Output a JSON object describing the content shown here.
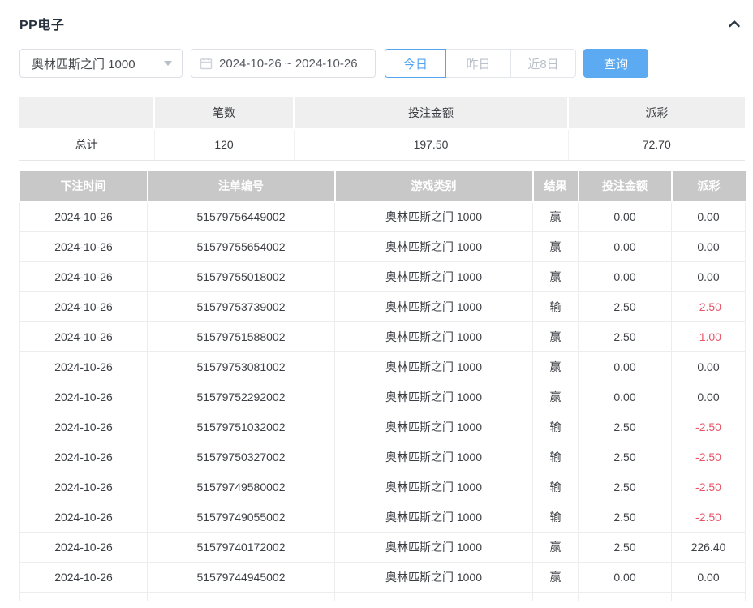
{
  "header": {
    "title": "PP电子",
    "collapse_icon": "chevron-up"
  },
  "filters": {
    "game_select": {
      "value": "奥林匹斯之门 1000",
      "icon": "chevron-down-icon"
    },
    "date_range": {
      "value": "2024-10-26 ~ 2024-10-26",
      "icon": "calendar-icon"
    },
    "quick": [
      {
        "label": "今日",
        "active": true
      },
      {
        "label": "昨日",
        "active": false
      },
      {
        "label": "近8日",
        "active": false
      }
    ],
    "query_label": "查询"
  },
  "summary": {
    "headers": [
      "",
      "笔数",
      "投注金额",
      "派彩"
    ],
    "total_label": "总计",
    "count": "120",
    "bet_amount": "197.50",
    "payout": "72.70"
  },
  "table": {
    "headers": [
      "下注时间",
      "注单编号",
      "游戏类别",
      "结果",
      "投注金额",
      "派彩"
    ],
    "rows": [
      {
        "date": "2024-10-26",
        "bet_id": "51579756449002",
        "game": "奥林匹斯之门 1000",
        "result": "赢",
        "amount": "0.00",
        "payout": "0.00",
        "payout_negative": false
      },
      {
        "date": "2024-10-26",
        "bet_id": "51579755654002",
        "game": "奥林匹斯之门 1000",
        "result": "赢",
        "amount": "0.00",
        "payout": "0.00",
        "payout_negative": false
      },
      {
        "date": "2024-10-26",
        "bet_id": "51579755018002",
        "game": "奥林匹斯之门 1000",
        "result": "赢",
        "amount": "0.00",
        "payout": "0.00",
        "payout_negative": false
      },
      {
        "date": "2024-10-26",
        "bet_id": "51579753739002",
        "game": "奥林匹斯之门 1000",
        "result": "输",
        "amount": "2.50",
        "payout": "-2.50",
        "payout_negative": true
      },
      {
        "date": "2024-10-26",
        "bet_id": "51579751588002",
        "game": "奥林匹斯之门 1000",
        "result": "赢",
        "amount": "2.50",
        "payout": "-1.00",
        "payout_negative": true
      },
      {
        "date": "2024-10-26",
        "bet_id": "51579753081002",
        "game": "奥林匹斯之门 1000",
        "result": "赢",
        "amount": "0.00",
        "payout": "0.00",
        "payout_negative": false
      },
      {
        "date": "2024-10-26",
        "bet_id": "51579752292002",
        "game": "奥林匹斯之门 1000",
        "result": "赢",
        "amount": "0.00",
        "payout": "0.00",
        "payout_negative": false
      },
      {
        "date": "2024-10-26",
        "bet_id": "51579751032002",
        "game": "奥林匹斯之门 1000",
        "result": "输",
        "amount": "2.50",
        "payout": "-2.50",
        "payout_negative": true
      },
      {
        "date": "2024-10-26",
        "bet_id": "51579750327002",
        "game": "奥林匹斯之门 1000",
        "result": "输",
        "amount": "2.50",
        "payout": "-2.50",
        "payout_negative": true
      },
      {
        "date": "2024-10-26",
        "bet_id": "51579749580002",
        "game": "奥林匹斯之门 1000",
        "result": "输",
        "amount": "2.50",
        "payout": "-2.50",
        "payout_negative": true
      },
      {
        "date": "2024-10-26",
        "bet_id": "51579749055002",
        "game": "奥林匹斯之门 1000",
        "result": "输",
        "amount": "2.50",
        "payout": "-2.50",
        "payout_negative": true
      },
      {
        "date": "2024-10-26",
        "bet_id": "51579740172002",
        "game": "奥林匹斯之门 1000",
        "result": "赢",
        "amount": "2.50",
        "payout": "226.40",
        "payout_negative": false
      },
      {
        "date": "2024-10-26",
        "bet_id": "51579744945002",
        "game": "奥林匹斯之门 1000",
        "result": "赢",
        "amount": "0.00",
        "payout": "0.00",
        "payout_negative": false
      }
    ]
  },
  "colors": {
    "accent_blue": "#5caaf2",
    "active_filter_blue": "#54a4f2",
    "negative_red": "#e85466",
    "table_header_gray": "#c8c8c8",
    "summary_header_gray": "#efefef"
  }
}
